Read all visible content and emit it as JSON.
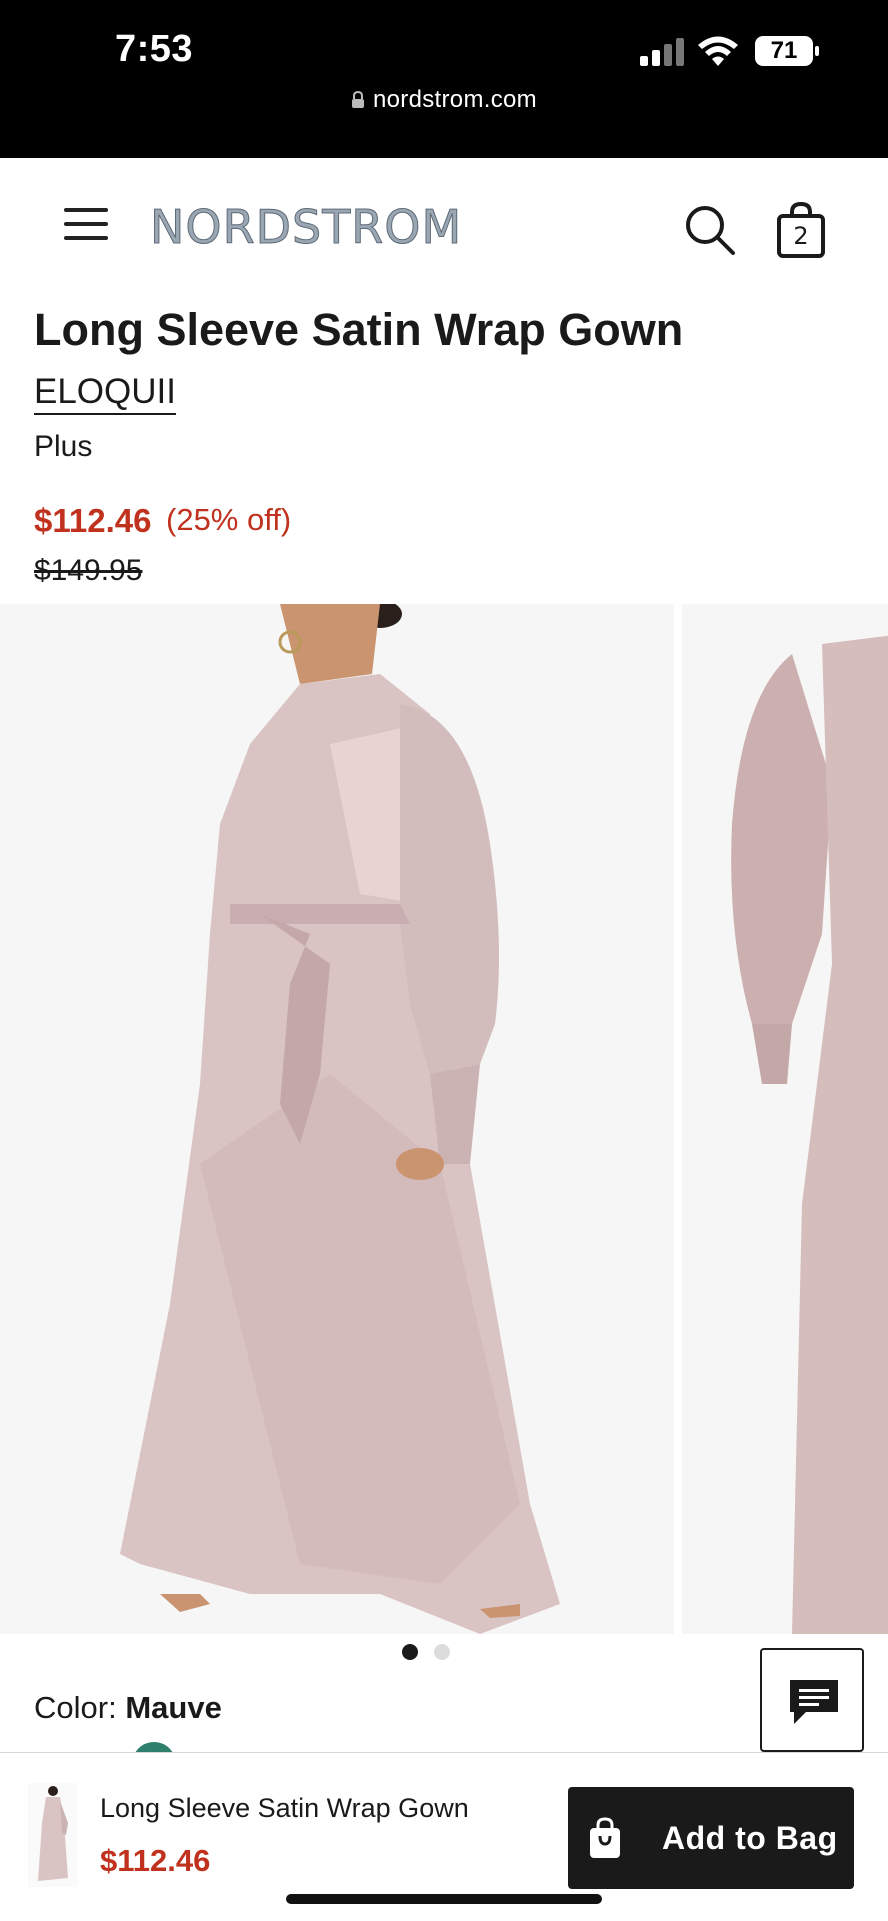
{
  "status_bar": {
    "time": "7:53",
    "battery": "71",
    "url": "nordstrom.com"
  },
  "header": {
    "logo": "NORDSTROM",
    "bag_count": "2"
  },
  "product": {
    "title": "Long Sleeve Satin Wrap Gown",
    "brand": "ELOQUII",
    "size_range": "Plus",
    "sale_price": "$112.46",
    "discount": "(25% off)",
    "original_price": "$149.95"
  },
  "carousel": {
    "slide_count": 2,
    "active_index": 0
  },
  "color": {
    "label": "Color:",
    "value": "Mauve"
  },
  "sticky_bar": {
    "title": "Long Sleeve Satin Wrap Gown",
    "price": "$112.46",
    "add_to_bag_label": "Add to Bag"
  },
  "colors": {
    "sale_red": "#c0321e",
    "dress_mauve": "#d9c2c2",
    "ink": "#1a1a1a"
  }
}
